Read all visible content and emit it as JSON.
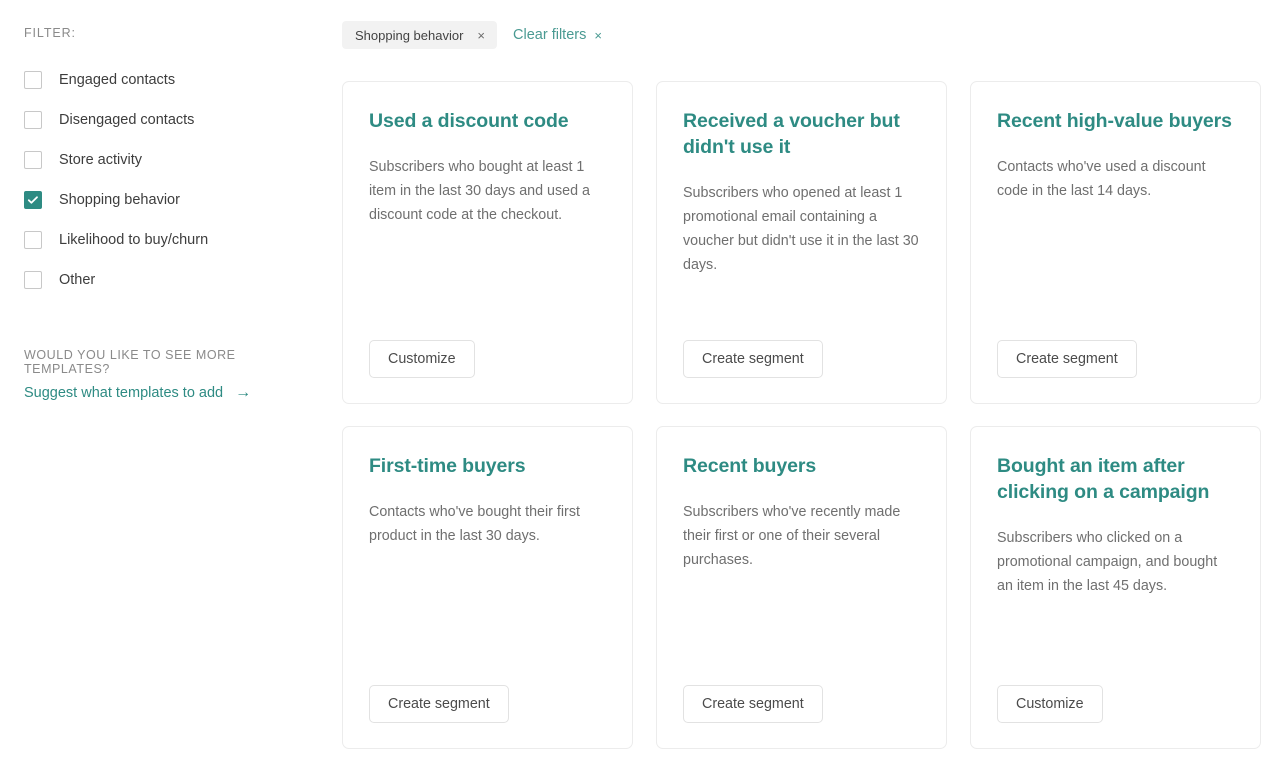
{
  "sidebar": {
    "filter_label": "FILTER:",
    "items": [
      {
        "label": "Engaged contacts",
        "checked": false
      },
      {
        "label": "Disengaged contacts",
        "checked": false
      },
      {
        "label": "Store activity",
        "checked": false
      },
      {
        "label": "Shopping behavior",
        "checked": true
      },
      {
        "label": "Likelihood to buy/churn",
        "checked": false
      },
      {
        "label": "Other",
        "checked": false
      }
    ],
    "suggest_caption": "WOULD YOU LIKE TO SEE MORE TEMPLATES?",
    "suggest_link": "Suggest what templates to add",
    "suggest_arrow": "→"
  },
  "filterbar": {
    "chips": [
      {
        "label": "Shopping behavior",
        "remove": "×"
      }
    ],
    "clear_label": "Clear filters",
    "clear_x": "×"
  },
  "cards": [
    {
      "title": "Used a discount code",
      "description": "Subscribers who bought at least 1 item in the last 30 days and used a discount code at the checkout.",
      "action": "Customize"
    },
    {
      "title": "Received a voucher but didn't use it",
      "description": "Subscribers who opened at least 1 promotional email containing a voucher but didn't use it in the last 30 days.",
      "action": "Create segment"
    },
    {
      "title": "Recent high-value buyers",
      "description": "Contacts who've used a discount code in the last 14 days.",
      "action": "Create segment"
    },
    {
      "title": "First-time buyers",
      "description": "Contacts who've bought their first product in the last 30 days.",
      "action": "Create segment"
    },
    {
      "title": "Recent buyers",
      "description": "Subscribers who've recently made their first or one of their several purchases.",
      "action": "Create segment"
    },
    {
      "title": "Bought an item after clicking on a campaign",
      "description": "Subscribers who clicked on a promotional campaign, and bought an item in the last 45 days.",
      "action": "Customize"
    }
  ],
  "colors": {
    "accent": "#2e8b83",
    "link": "#4a9a92",
    "text": "#3d3d3d",
    "muted": "#6f6f6f",
    "caption": "#8a8a8a",
    "card_border": "#ececec",
    "chip_bg": "#f2f2f2"
  }
}
